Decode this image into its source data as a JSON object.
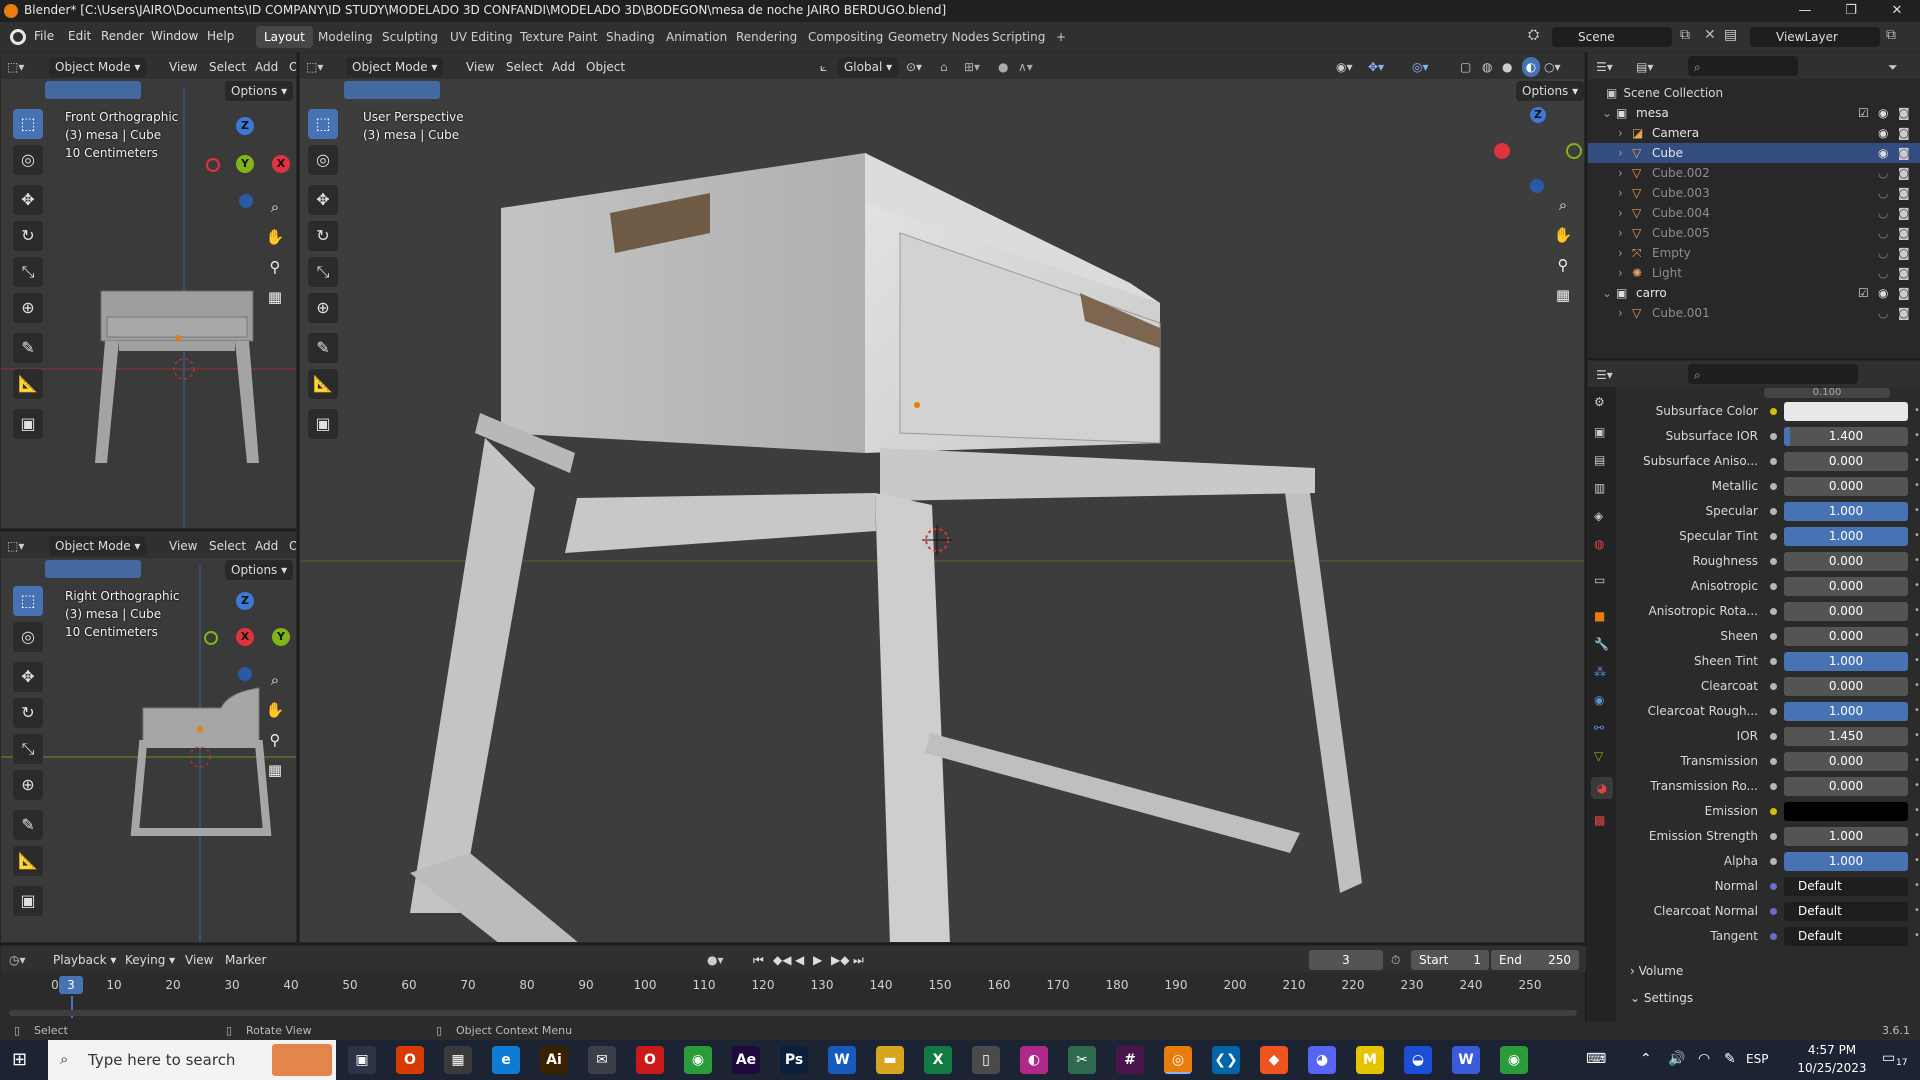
{
  "titlebar": {
    "title": "Blender* [C:\\Users\\JAIRO\\Documents\\ID COMPANY\\ID STUDY\\MODELADO 3D CONFANDI\\MODELADO 3D\\BODEGON\\mesa de noche JAIRO BERDUGO.blend]",
    "minimize": "—",
    "maximize": "❐",
    "close": "✕"
  },
  "menubar": {
    "menus": [
      "File",
      "Edit",
      "Render",
      "Window",
      "Help"
    ],
    "workspaces": [
      "Layout",
      "Modeling",
      "Sculpting",
      "UV Editing",
      "Texture Paint",
      "Shading",
      "Animation",
      "Rendering",
      "Compositing",
      "Geometry Nodes",
      "Scripting"
    ],
    "add_tab": "+",
    "scene": "Scene",
    "view_layer": "ViewLayer"
  },
  "viewport_header": {
    "mode": "Object Mode",
    "menus": [
      "View",
      "Select",
      "Add",
      "Object"
    ],
    "orientation": "Global",
    "options": "Options"
  },
  "small_header": {
    "mode": "Object Mode",
    "menus": [
      "View",
      "Select",
      "Add",
      "O"
    ],
    "options": "Options"
  },
  "front_view": {
    "name": "Front Orthographic",
    "object": "(3) mesa | Cube",
    "scale": "10 Centimeters"
  },
  "right_view": {
    "name": "Right Orthographic",
    "object": "(3) mesa | Cube",
    "scale": "10 Centimeters"
  },
  "main_view": {
    "name": "User Perspective",
    "object": "(3) mesa | Cube"
  },
  "axes": {
    "x": "X",
    "y": "Y",
    "z": "Z"
  },
  "outliner": {
    "root": "Scene Collection",
    "items": [
      {
        "name": "mesa",
        "type": "collection",
        "enabled": true
      },
      {
        "name": "Camera",
        "type": "camera",
        "enabled": true
      },
      {
        "name": "Cube",
        "type": "mesh",
        "enabled": true
      },
      {
        "name": "Cube.002",
        "type": "mesh",
        "enabled": false
      },
      {
        "name": "Cube.003",
        "type": "mesh",
        "enabled": false
      },
      {
        "name": "Cube.004",
        "type": "mesh",
        "enabled": false
      },
      {
        "name": "Cube.005",
        "type": "mesh",
        "enabled": false
      },
      {
        "name": "Empty",
        "type": "empty",
        "enabled": false
      },
      {
        "name": "Light",
        "type": "light",
        "enabled": false
      },
      {
        "name": "carro",
        "type": "collection",
        "enabled": true
      },
      {
        "name": "Cube.001",
        "type": "mesh",
        "enabled": false
      }
    ]
  },
  "properties": {
    "partial_value": "0.100",
    "rows": [
      {
        "label": "Subsurface Color",
        "value": "",
        "kind": "color",
        "color": "#e8e8e8",
        "fill": 0
      },
      {
        "label": "Subsurface IOR",
        "value": "1.400",
        "kind": "num",
        "fill": 0.05
      },
      {
        "label": "Subsurface Aniso...",
        "value": "0.000",
        "kind": "num",
        "fill": 0
      },
      {
        "label": "Metallic",
        "value": "0.000",
        "kind": "num",
        "fill": 0
      },
      {
        "label": "Specular",
        "value": "1.000",
        "kind": "num",
        "fill": 1
      },
      {
        "label": "Specular Tint",
        "value": "1.000",
        "kind": "num",
        "fill": 1
      },
      {
        "label": "Roughness",
        "value": "0.000",
        "kind": "num",
        "fill": 0
      },
      {
        "label": "Anisotropic",
        "value": "0.000",
        "kind": "num",
        "fill": 0
      },
      {
        "label": "Anisotropic Rota...",
        "value": "0.000",
        "kind": "num",
        "fill": 0
      },
      {
        "label": "Sheen",
        "value": "0.000",
        "kind": "num",
        "fill": 0
      },
      {
        "label": "Sheen Tint",
        "value": "1.000",
        "kind": "num",
        "fill": 1
      },
      {
        "label": "Clearcoat",
        "value": "0.000",
        "kind": "num",
        "fill": 0
      },
      {
        "label": "Clearcoat Rough...",
        "value": "1.000",
        "kind": "num",
        "fill": 1
      },
      {
        "label": "IOR",
        "value": "1.450",
        "kind": "num",
        "fill": 0
      },
      {
        "label": "Transmission",
        "value": "0.000",
        "kind": "num",
        "fill": 0
      },
      {
        "label": "Transmission Ro...",
        "value": "0.000",
        "kind": "num",
        "fill": 0
      },
      {
        "label": "Emission",
        "value": "",
        "kind": "color",
        "color": "#000000",
        "fill": 0
      },
      {
        "label": "Emission Strength",
        "value": "1.000",
        "kind": "num",
        "fill": 0
      },
      {
        "label": "Alpha",
        "value": "1.000",
        "kind": "num",
        "fill": 1
      },
      {
        "label": "Normal",
        "value": "Default",
        "kind": "text",
        "fill": 0
      },
      {
        "label": "Clearcoat Normal",
        "value": "Default",
        "kind": "text",
        "fill": 0
      },
      {
        "label": "Tangent",
        "value": "Default",
        "kind": "text",
        "fill": 0
      }
    ],
    "sections": [
      "Volume",
      "Settings"
    ]
  },
  "timeline": {
    "menus": [
      "Playback",
      "Keying",
      "View",
      "Marker"
    ],
    "current_frame": "3",
    "start_label": "Start",
    "start": "1",
    "end_label": "End",
    "end": "250",
    "ticks": [
      "0",
      "10",
      "20",
      "30",
      "40",
      "50",
      "60",
      "70",
      "80",
      "90",
      "100",
      "110",
      "120",
      "130",
      "140",
      "150",
      "160",
      "170",
      "180",
      "190",
      "200",
      "210",
      "220",
      "230",
      "240",
      "250"
    ]
  },
  "statusbar": {
    "select": "Select",
    "rotate": "Rotate View",
    "context": "Object Context Menu",
    "version": "3.6.1"
  },
  "taskbar": {
    "search_placeholder": "Type here to search",
    "language": "ESP",
    "time": "4:57 PM",
    "date": "10/25/2023",
    "notifications": "17",
    "apps": [
      {
        "name": "task-view",
        "glyph": "▣",
        "color": "#2b3547"
      },
      {
        "name": "office",
        "glyph": "O",
        "color": "#d83b01"
      },
      {
        "name": "calculator",
        "glyph": "▦",
        "color": "#3a3a3a"
      },
      {
        "name": "edge",
        "glyph": "e",
        "color": "#0f7bd4"
      },
      {
        "name": "illustrator",
        "glyph": "Ai",
        "color": "#3a2200"
      },
      {
        "name": "mail",
        "glyph": "✉",
        "color": "#3a3f4a"
      },
      {
        "name": "opera",
        "glyph": "O",
        "color": "#cc1a1a"
      },
      {
        "name": "chrome",
        "glyph": "◉",
        "color": "#2a9d3a"
      },
      {
        "name": "after-effects",
        "glyph": "Ae",
        "color": "#1f0a3d"
      },
      {
        "name": "photoshop",
        "glyph": "Ps",
        "color": "#0b1f3b"
      },
      {
        "name": "word",
        "glyph": "W",
        "color": "#185abd"
      },
      {
        "name": "file-explorer",
        "glyph": "▬",
        "color": "#d8a61e"
      },
      {
        "name": "excel",
        "glyph": "X",
        "color": "#107c41"
      },
      {
        "name": "notepad",
        "glyph": "▯",
        "color": "#4a4a4a"
      },
      {
        "name": "paint",
        "glyph": "◐",
        "color": "#b0298a"
      },
      {
        "name": "snipping",
        "glyph": "✂",
        "color": "#2e6b4f"
      },
      {
        "name": "slack",
        "glyph": "#",
        "color": "#4a154b"
      },
      {
        "name": "blender",
        "glyph": "◎",
        "color": "#e87d0d"
      },
      {
        "name": "vscode",
        "glyph": "❮❯",
        "color": "#0065a9"
      },
      {
        "name": "brave",
        "glyph": "◆",
        "color": "#f0541e"
      },
      {
        "name": "discord",
        "glyph": "◕",
        "color": "#5865f2"
      },
      {
        "name": "miro",
        "glyph": "M",
        "color": "#e8c400"
      },
      {
        "name": "browser",
        "glyph": "◒",
        "color": "#1d4ed8"
      },
      {
        "name": "teams",
        "glyph": "W",
        "color": "#3b5bdb"
      },
      {
        "name": "chrome-2",
        "glyph": "◉",
        "color": "#2a9d3a"
      }
    ]
  },
  "colors": {
    "accent": "#4772b3",
    "active_object": "#e87d0d",
    "x_axis": "#e0333f",
    "y_axis": "#7fb519",
    "z_axis": "#3d79d6"
  }
}
